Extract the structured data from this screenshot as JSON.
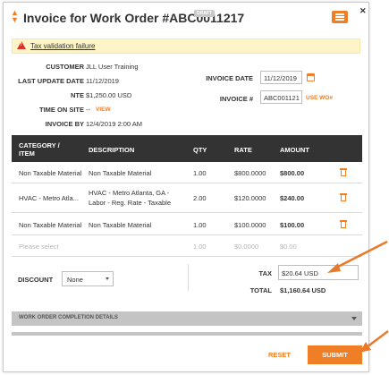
{
  "header": {
    "title": "Invoice for Work Order #ABC0011217",
    "badge": "DRAFT"
  },
  "alert": {
    "text": "Tax validation failure"
  },
  "details": {
    "customer_label": "CUSTOMER",
    "customer_value": "JLL User Training",
    "last_update_label": "LAST UPDATE DATE",
    "last_update_value": "11/12/2019",
    "nte_label": "NTE",
    "nte_value": "$1,250.00 USD",
    "time_on_site_label": "TIME ON SITE",
    "time_on_site_value": "--",
    "view_link": "VIEW",
    "invoice_by_label": "INVOICE BY",
    "invoice_by_value": "12/4/2019 2:00 AM",
    "invoice_date_label": "INVOICE DATE",
    "invoice_date_value": "11/12/2019",
    "invoice_num_label": "INVOICE #",
    "invoice_num_value": "ABC001121",
    "use_wo_link": "USE WO#"
  },
  "table": {
    "columns": [
      "CATEGORY /",
      "ITEM",
      "DESCRIPTION",
      "QTY",
      "RATE",
      "AMOUNT"
    ],
    "rows": [
      {
        "category": "Non Taxable Material",
        "description": "Non Taxable Material",
        "qty": "1.00",
        "rate": "$800.0000",
        "amount": "$800.00"
      },
      {
        "category": "HVAC - Metro Atla...",
        "description_line1": "HVAC - Metro Atlanta, GA -",
        "description_line2": "Labor - Reg. Rate - Taxable",
        "qty": "2.00",
        "rate": "$120.0000",
        "amount": "$240.00"
      },
      {
        "category": "Non Taxable Material",
        "description": "Non Taxable Material",
        "qty": "1.00",
        "rate": "$100.0000",
        "amount": "$100.00"
      }
    ],
    "new_row": {
      "placeholder": "Please select",
      "qty": "1.00",
      "rate": "$0.0000",
      "amount": "$0.00"
    }
  },
  "totals": {
    "discount_label": "DISCOUNT",
    "discount_value": "None",
    "tax_label": "TAX",
    "tax_value": "$20.64 USD",
    "total_label": "TOTAL",
    "total_value": "$1,160.64 USD"
  },
  "section": {
    "title": "WORK ORDER COMPLETION DETAILS"
  },
  "footer": {
    "reset": "RESET",
    "submit": "SUBMIT"
  },
  "colors": {
    "accent": "#f07e26",
    "table_header": "#333333",
    "alert_bg": "#fdf4c8",
    "error": "#d9342b"
  },
  "icons": [
    "drag-handle-icon",
    "menu-icon",
    "close-icon",
    "warning-icon",
    "calendar-icon",
    "trash-icon",
    "chevron-down-icon"
  ]
}
